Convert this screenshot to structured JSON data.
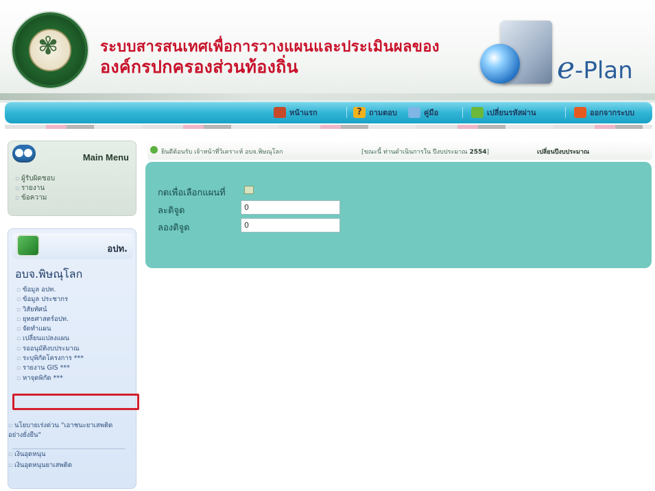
{
  "header": {
    "title_line1": "ระบบสารสนเทศเพื่อการวางแผนและประเมินผลของ",
    "title_line2": "องค์กรปกครองส่วนท้องถิ่น",
    "logo_text": "e-Plan",
    "logo_e": "e",
    "logo_rest": "-Plan"
  },
  "nav": {
    "items": [
      {
        "label": "หน้าแรก",
        "icon": "home-icon"
      },
      {
        "label": "ถามตอบ",
        "icon": "question-icon"
      },
      {
        "label": "คู่มือ",
        "icon": "book-icon"
      },
      {
        "label": "เปลี่ยนรหัสผ่าน",
        "icon": "key-icon"
      },
      {
        "label": "ออกจากระบบ",
        "icon": "logout-icon"
      }
    ]
  },
  "main_menu": {
    "title": "Main Menu",
    "items": [
      "ผู้รับผิดชอบ",
      "รายงาน",
      "ข้อความ"
    ]
  },
  "opk": {
    "label": "อปท.",
    "org_name": "อบจ.พิษณุโลก",
    "items": [
      "ข้อมูล อปท.",
      "ข้อมูล ประชากร",
      "วิสัยทัศน์",
      "ยุทธศาสตร์อปท.",
      "จัดทำแผน",
      "เปลี่ยนแปลงแผน",
      "รออนุมัติงบประมาณ",
      "ระบุพิกัดโครงการ ***",
      "รายงาน GIS ***",
      "หาจุดพิกัด ***"
    ],
    "extra_items": [
      "นโยบายเร่งด่วน \"เอาชนะยาเสพติดอย่างยั่งยืน\"",
      "เงินอุดหนุน",
      "เงินอุดหนุนยาเสพติด"
    ]
  },
  "welcome": {
    "greeting": "ยินดีต้อนรับ เจ้าหน้าที่วิเคราะห์ อบจ.พิษณุโลก",
    "fiscal_prefix": "[ขณะนี้ ท่านดำเนินการใน ปีงบประมาณ",
    "fiscal_year": "2554",
    "fiscal_suffix": "]",
    "change_label": "เปลี่ยนปีงบประมาณ"
  },
  "content": {
    "select_map_label": "กดเพื่อเลือกแผนที่",
    "lat_label": "ละติจูด",
    "lat_value": "0",
    "lng_label": "ลองติจูด",
    "lng_value": "0"
  },
  "colors": {
    "title_red": "#c8112a",
    "nav_blue": "#33b6d6",
    "panel_teal": "#72c9bf",
    "highlight_red": "#d41e2c"
  }
}
